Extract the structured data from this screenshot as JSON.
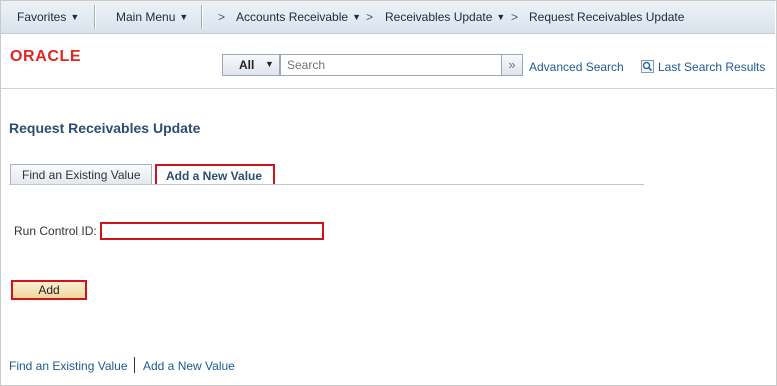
{
  "nav": {
    "favorites": "Favorites",
    "main_menu": "Main Menu",
    "breadcrumb": [
      "Accounts Receivable",
      "Receivables Update",
      "Request Receivables Update"
    ]
  },
  "header": {
    "logo": "ORACLE",
    "search_scope": "All",
    "search_placeholder": "Search",
    "advanced_search": "Advanced Search",
    "last_search_results": "Last Search Results"
  },
  "page": {
    "title": "Request Receivables Update",
    "tabs": [
      "Find an Existing Value",
      "Add a New Value"
    ],
    "active_tab": "Add a New Value",
    "run_control_label": "Run Control ID:",
    "run_control_value": "",
    "add_button": "Add"
  },
  "footer": {
    "links": [
      "Find an Existing Value",
      "Add a New Value"
    ]
  },
  "colors": {
    "highlight": "#d0131b",
    "link": "#1f5a92",
    "brand": "#e0271f"
  }
}
